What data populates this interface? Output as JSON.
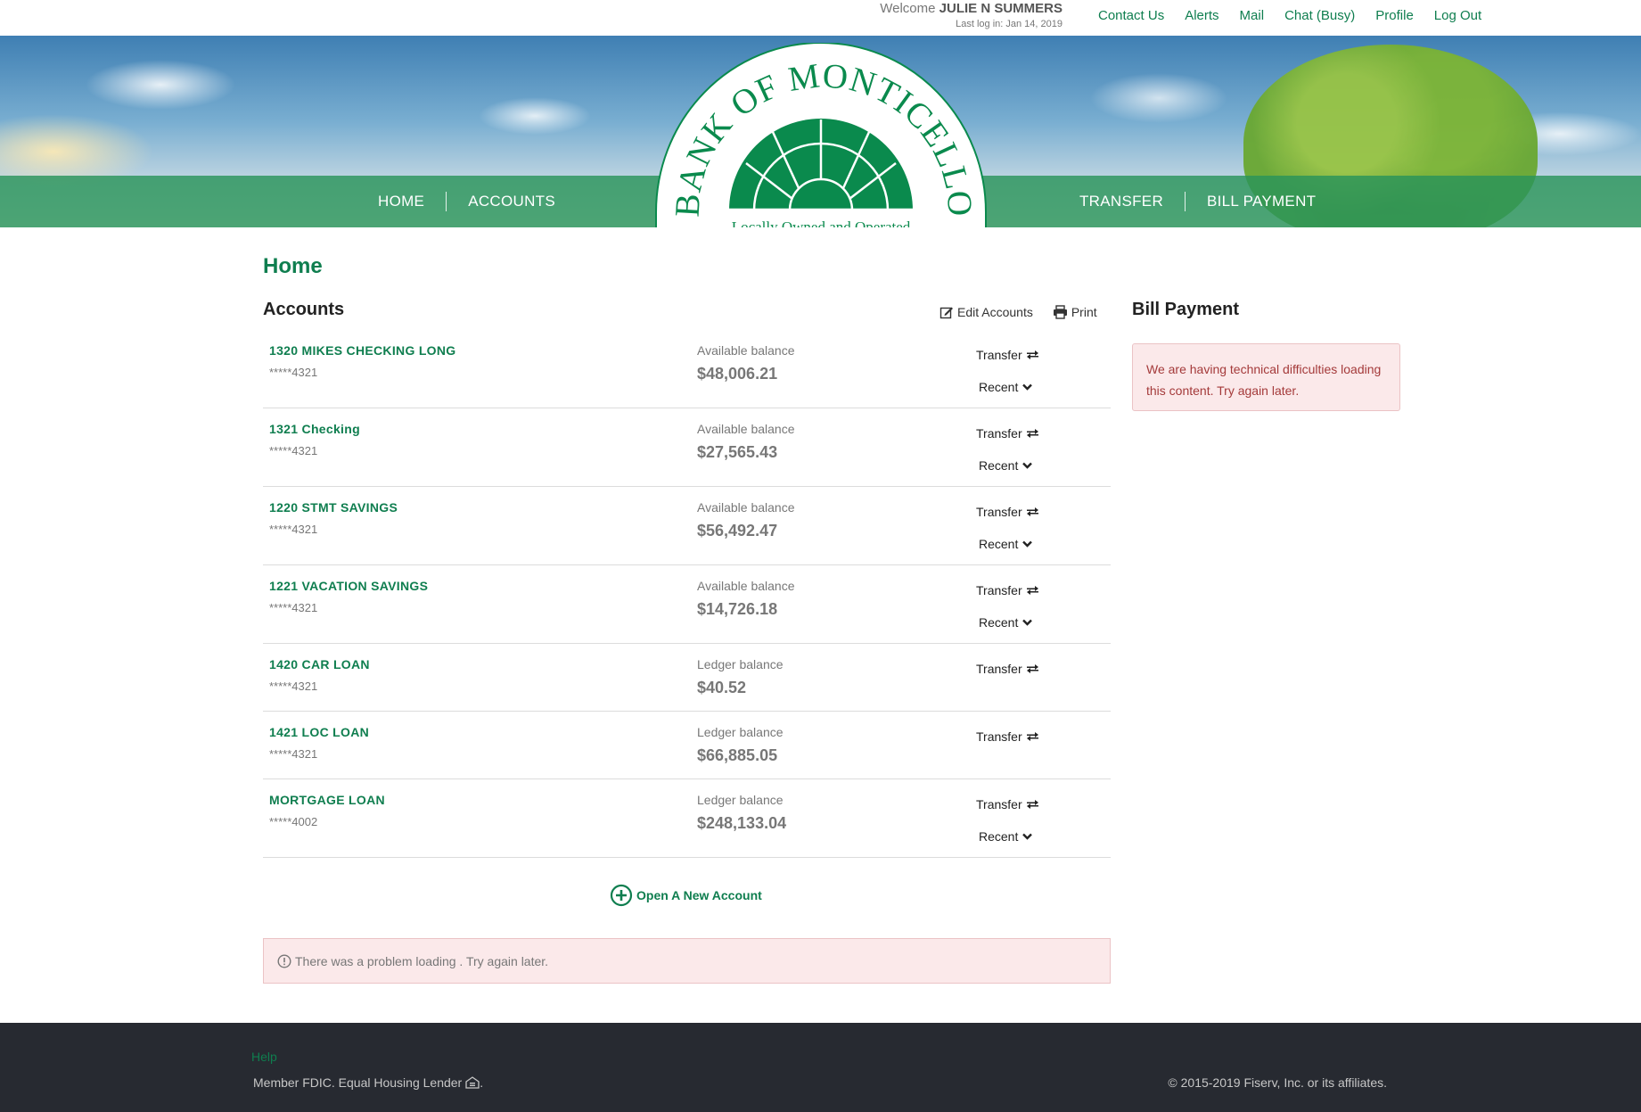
{
  "header": {
    "welcome_prefix": "Welcome",
    "user_name": "JULIE N SUMMERS",
    "last_login": "Last log in: Jan 14, 2019",
    "links": [
      "Contact Us",
      "Alerts",
      "Mail",
      "Chat (Busy)",
      "Profile",
      "Log Out"
    ]
  },
  "nav": {
    "left": [
      "HOME",
      "ACCOUNTS"
    ],
    "right": [
      "TRANSFER",
      "BILL PAYMENT"
    ]
  },
  "logo": {
    "name": "BANK OF MONTICELLO",
    "tagline": "Locally Owned and Operated"
  },
  "main": {
    "page_title": "Home",
    "accounts_heading": "Accounts",
    "edit_accounts": "Edit Accounts",
    "print": "Print",
    "transfer_label": "Transfer",
    "recent_label": "Recent",
    "accounts": [
      {
        "name": "1320 MIKES CHECKING LONG",
        "number": "*****4321",
        "balance_label": "Available balance",
        "balance": "$48,006.21",
        "recent": true
      },
      {
        "name": "1321 Checking",
        "number": "*****4321",
        "balance_label": "Available balance",
        "balance": "$27,565.43",
        "recent": true
      },
      {
        "name": "1220 STMT SAVINGS",
        "number": "*****4321",
        "balance_label": "Available balance",
        "balance": "$56,492.47",
        "recent": true
      },
      {
        "name": "1221 VACATION SAVINGS",
        "number": "*****4321",
        "balance_label": "Available balance",
        "balance": "$14,726.18",
        "recent": true
      },
      {
        "name": "1420 CAR LOAN",
        "number": "*****4321",
        "balance_label": "Ledger balance",
        "balance": "$40.52",
        "recent": false
      },
      {
        "name": "1421 LOC LOAN",
        "number": "*****4321",
        "balance_label": "Ledger balance",
        "balance": "$66,885.05",
        "recent": false
      },
      {
        "name": "MORTGAGE LOAN",
        "number": "*****4002",
        "balance_label": "Ledger balance",
        "balance": "$248,133.04",
        "recent": true
      }
    ],
    "open_account": "Open A New Account",
    "load_error": "There was a problem loading . Try again later."
  },
  "bill_payment": {
    "heading": "Bill Payment",
    "error": "We are having technical difficulties loading this content. Try again later."
  },
  "footer": {
    "help": "Help",
    "fdic": "Member FDIC. Equal Housing Lender",
    "fdic_suffix": ".",
    "copyright": "© 2015-2019 Fiserv, Inc. or its affiliates."
  },
  "colors": {
    "brand_green": "#0f7e4f",
    "nav_band": "#2a945a",
    "alert_bg": "#fbe9ea",
    "alert_text": "#a43a3a",
    "footer_bg": "#272a31"
  },
  "icons": [
    "edit-icon",
    "print-icon",
    "transfer-icon",
    "chevron-down-icon",
    "plus-circle-icon",
    "info-circle-icon",
    "equal-housing-icon"
  ]
}
